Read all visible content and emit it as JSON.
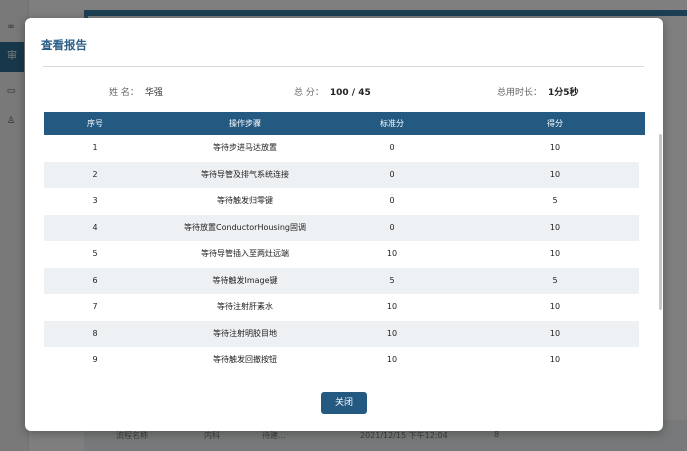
{
  "background": {
    "sidebar_active_label": "审",
    "row": [
      "流程名称",
      "内科",
      "待建...",
      "2021/12/15 下午12:04",
      "8"
    ]
  },
  "dialog": {
    "title": "查看报告",
    "summary": {
      "name_label": "姓 名：",
      "name_value": "华强",
      "score_label": "总 分：",
      "score_value": "100 / 45",
      "time_label": "总用时长：",
      "time_value": "1分5秒"
    },
    "table": {
      "headers": [
        "序号",
        "操作步骤",
        "标准分",
        "得分"
      ],
      "rows": [
        {
          "no": "1",
          "step": "等待步进马达放置",
          "standard": "0",
          "score": "10"
        },
        {
          "no": "2",
          "step": "等待导管及排气系统连接",
          "standard": "0",
          "score": "10"
        },
        {
          "no": "3",
          "step": "等待触发归零键",
          "standard": "0",
          "score": "5"
        },
        {
          "no": "4",
          "step": "等待放置ConductorHousing固调",
          "standard": "0",
          "score": "10"
        },
        {
          "no": "5",
          "step": "等待导管插入至两灶远端",
          "standard": "10",
          "score": "10"
        },
        {
          "no": "6",
          "step": "等待触发Image键",
          "standard": "5",
          "score": "5"
        },
        {
          "no": "7",
          "step": "等待注射肝素水",
          "standard": "10",
          "score": "10"
        },
        {
          "no": "8",
          "step": "等待注射明胶目地",
          "standard": "10",
          "score": "10"
        },
        {
          "no": "9",
          "step": "等待触发回撤按钮",
          "standard": "10",
          "score": "10"
        }
      ]
    },
    "close_label": "关闭"
  }
}
